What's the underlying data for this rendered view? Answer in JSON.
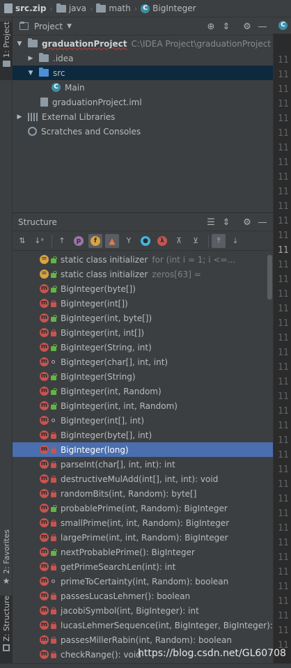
{
  "navbar": {
    "crumbs": [
      {
        "label": "src.zip",
        "icon": "zip-archive-icon"
      },
      {
        "label": "java",
        "icon": "folder-icon"
      },
      {
        "label": "math",
        "icon": "folder-icon"
      },
      {
        "label": "BigInteger",
        "icon": "class-icon"
      }
    ]
  },
  "left_stripe": {
    "project_tab": "1: Project",
    "favorites_tab": "2: Favorites",
    "structure_tab": "Z: Structure"
  },
  "project": {
    "title": "Project",
    "tree": [
      {
        "label": "graduationProject",
        "path": "C:\\IDEA Project\\graduationProject"
      },
      {
        "label": ".idea"
      },
      {
        "label": "src"
      },
      {
        "label": "Main"
      },
      {
        "label": "graduationProject.iml"
      },
      {
        "label": "External Libraries"
      },
      {
        "label": "Scratches and Consoles"
      }
    ]
  },
  "structure": {
    "title": "Structure",
    "items": [
      {
        "label": "static class initializer",
        "extra": "for (int i = 1; i <=...",
        "kind": "initializer",
        "vis": "public"
      },
      {
        "label": "static class initializer",
        "extra": "zeros[63] =",
        "kind": "initializer",
        "vis": "public"
      },
      {
        "label": "BigInteger(byte[])",
        "kind": "method",
        "vis": "public"
      },
      {
        "label": "BigInteger(int[])",
        "kind": "method",
        "vis": "private"
      },
      {
        "label": "BigInteger(int, byte[])",
        "kind": "method",
        "vis": "public"
      },
      {
        "label": "BigInteger(int, int[])",
        "kind": "method",
        "vis": "private"
      },
      {
        "label": "BigInteger(String, int)",
        "kind": "method",
        "vis": "public"
      },
      {
        "label": "BigInteger(char[], int, int)",
        "kind": "method",
        "vis": "package"
      },
      {
        "label": "BigInteger(String)",
        "kind": "method",
        "vis": "public"
      },
      {
        "label": "BigInteger(int, Random)",
        "kind": "method",
        "vis": "public"
      },
      {
        "label": "BigInteger(int, int, Random)",
        "kind": "method",
        "vis": "public"
      },
      {
        "label": "BigInteger(int[], int)",
        "kind": "method",
        "vis": "package"
      },
      {
        "label": "BigInteger(byte[], int)",
        "kind": "method",
        "vis": "private"
      },
      {
        "label": "BigInteger(long)",
        "kind": "method",
        "vis": "private"
      },
      {
        "label": "parseInt(char[], int, int): int",
        "kind": "method",
        "vis": "private"
      },
      {
        "label": "destructiveMulAdd(int[], int, int): void",
        "kind": "method",
        "vis": "private"
      },
      {
        "label": "randomBits(int, Random): byte[]",
        "kind": "method",
        "vis": "private"
      },
      {
        "label": "probablePrime(int, Random): BigInteger",
        "kind": "method",
        "vis": "public"
      },
      {
        "label": "smallPrime(int, int, Random): BigInteger",
        "kind": "method",
        "vis": "private"
      },
      {
        "label": "largePrime(int, int, Random): BigInteger",
        "kind": "method",
        "vis": "private"
      },
      {
        "label": "nextProbablePrime(): BigInteger",
        "kind": "method",
        "vis": "public"
      },
      {
        "label": "getPrimeSearchLen(int): int",
        "kind": "method",
        "vis": "private"
      },
      {
        "label": "primeToCertainty(int, Random): boolean",
        "kind": "method",
        "vis": "package"
      },
      {
        "label": "passesLucasLehmer(): boolean",
        "kind": "method",
        "vis": "private"
      },
      {
        "label": "jacobiSymbol(int, BigInteger): int",
        "kind": "method",
        "vis": "private"
      },
      {
        "label": "lucasLehmerSequence(int, BigInteger, BigInteger): B",
        "kind": "method",
        "vis": "private"
      },
      {
        "label": "passesMillerRabin(int, Random): boolean",
        "kind": "method",
        "vis": "private"
      },
      {
        "label": "checkRange(): void",
        "kind": "method",
        "vis": "private"
      }
    ],
    "selected_index": 13
  },
  "editor": {
    "line_number_text": "11"
  },
  "watermark": "https://blog.csdn.net/GL60708",
  "colors": {
    "background": "#3c3f41",
    "selection": "#4b6eaf",
    "method_icon": "#c75450",
    "public_lock": "#62b543",
    "private_lock": "#c75450"
  }
}
